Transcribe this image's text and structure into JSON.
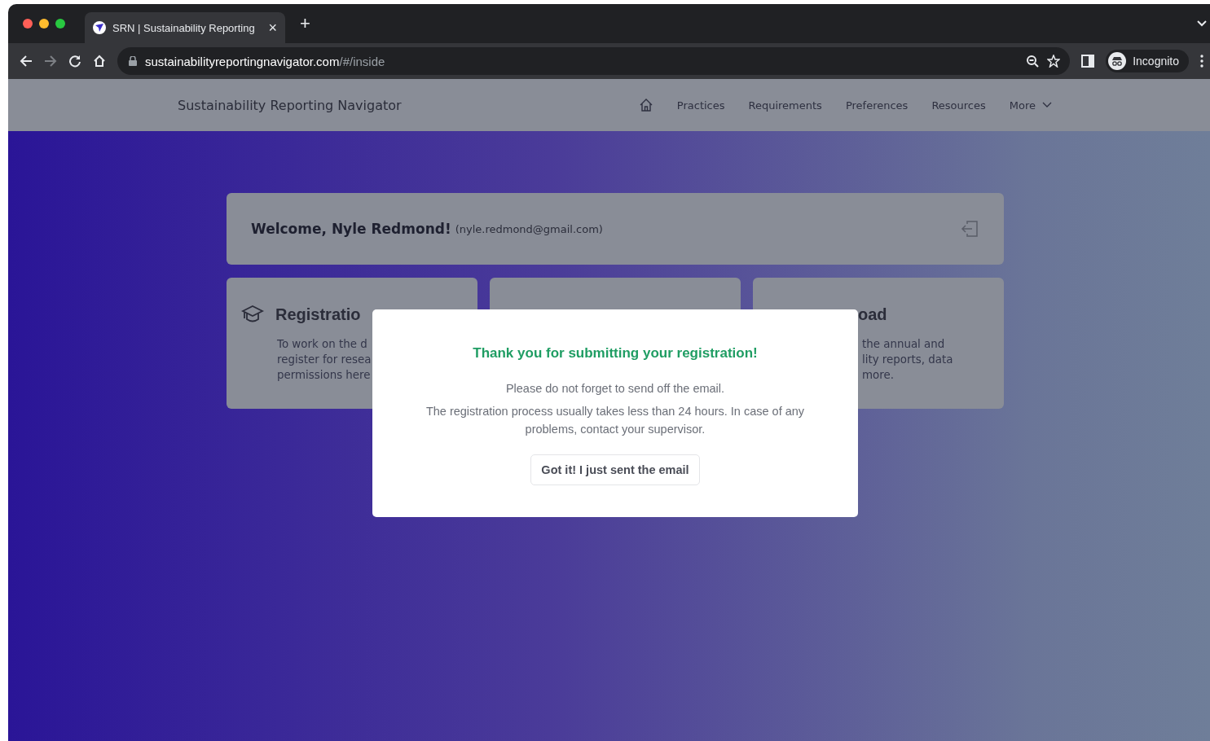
{
  "browser": {
    "tab_title": "SRN | Sustainability Reporting",
    "tab_close": "×",
    "new_tab": "+",
    "url_host": "sustainabilityreportingnavigator.com",
    "url_path": "/#/inside",
    "profile": "Incognito"
  },
  "header": {
    "brand": "Sustainability Reporting Navigator",
    "nav": [
      "Practices",
      "Requirements",
      "Preferences",
      "Resources"
    ],
    "more": "More"
  },
  "welcome": {
    "greeting": "Welcome, Nyle Redmond!",
    "email": "(nyle.redmond@gmail.com)"
  },
  "cards": [
    {
      "kind": "left",
      "title": "Registratio",
      "lines": [
        "To work on the d",
        "register for resea",
        "permissions here"
      ]
    },
    {
      "kind": "middle"
    },
    {
      "kind": "right",
      "title": "oad",
      "lines": [
        "the annual and",
        "lity reports, data",
        "more."
      ]
    }
  ],
  "modal": {
    "title": "Thank you for submitting your registration!",
    "lines": [
      "Please do not forget to send off the email.",
      "The registration process usually takes less than 24 hours. In case of any problems, contact your supervisor."
    ],
    "button": "Got it! I just sent the email"
  }
}
